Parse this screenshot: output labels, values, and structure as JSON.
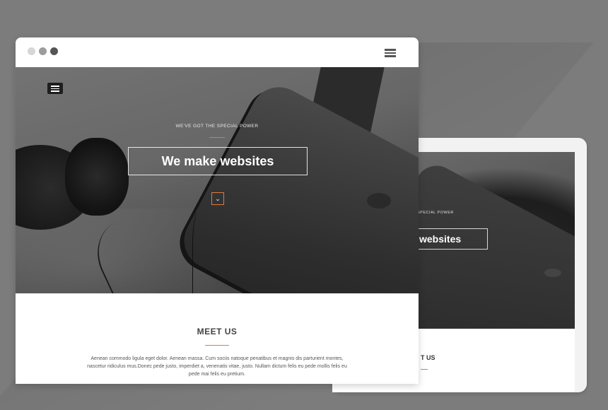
{
  "browser": {
    "hero": {
      "tagline": "WE'VE GOT THE SPECIAL POWER",
      "title": "We make websites",
      "down_icon": "chevron-down-icon"
    },
    "meet": {
      "title": "MEET US",
      "text": "Aenean commodo ligula eget dolor. Aenean massa. Cum sociis natoque penatibus et magnis dis parturient montes, nascetur ridiculus mus.Donec pede justo, imperdiet a, venenatis vitae, justo. Nullam dictum felis eu pede mollis felis eu pede mai felis eu pretium."
    }
  },
  "tablet": {
    "tagline": "SPECIAL POWER",
    "title": "websites",
    "meet": "T US"
  },
  "colors": {
    "background": "#7c7c7d",
    "accent": "#e07a3c"
  }
}
